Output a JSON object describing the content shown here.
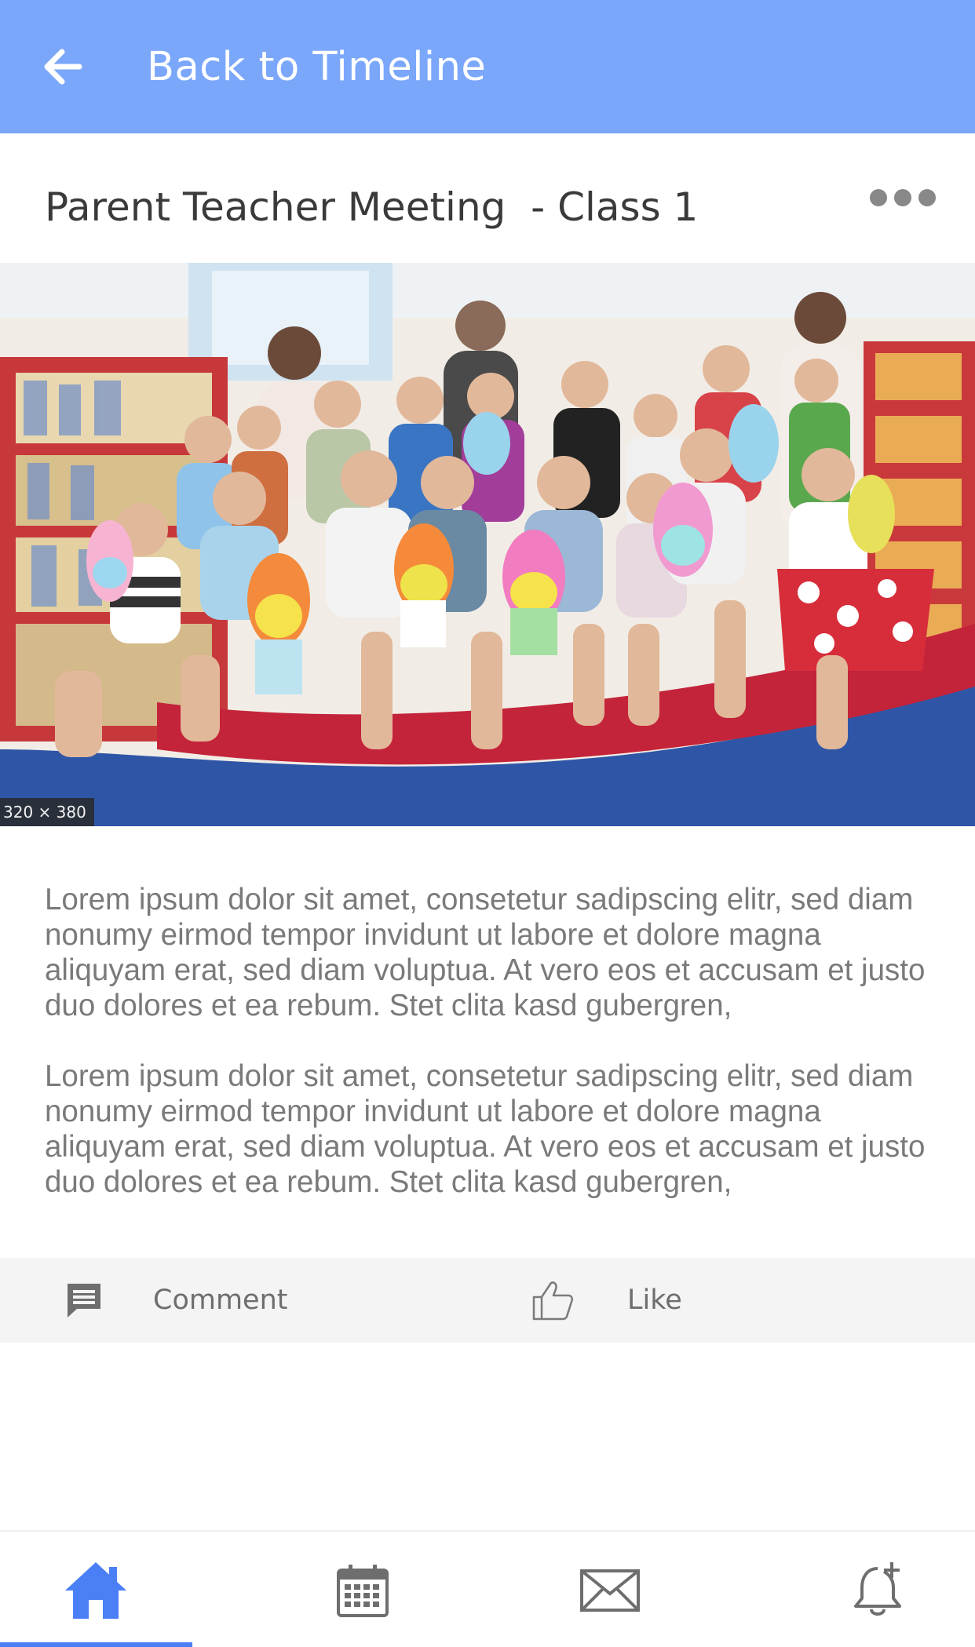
{
  "appbar": {
    "title": "Back to Timeline",
    "back_icon": "arrow-left-icon",
    "background": "#7ba7fb"
  },
  "post": {
    "title": "Parent Teacher Meeting  - Class 1",
    "more_icon": "more-dots-icon",
    "image_dimension_tag": "320 × 380",
    "paragraphs": [
      "Lorem ipsum dolor sit amet, consetetur sadipscing elitr, sed diam nonumy eirmod tempor invidunt ut labore et dolore magna aliquyam erat, sed diam voluptua. At vero eos et accusam et justo duo dolores et ea rebum. Stet clita kasd gubergren,",
      "Lorem ipsum dolor sit amet, consetetur sadipscing elitr, sed diam nonumy eirmod tempor invidunt ut labore et dolore magna aliquyam erat, sed diam voluptua. At vero eos et accusam et justo duo dolores et ea rebum. Stet clita kasd gubergren,"
    ]
  },
  "actions": {
    "comment_label": "Comment",
    "comment_icon": "comment-icon",
    "like_label": "Like",
    "like_icon": "thumbs-up-icon"
  },
  "bottom_nav": {
    "active": "home",
    "accent": "#4a7ff5",
    "items": [
      {
        "id": "home",
        "icon": "home-icon"
      },
      {
        "id": "calendar",
        "icon": "calendar-icon"
      },
      {
        "id": "messages",
        "icon": "mail-icon"
      },
      {
        "id": "notifications",
        "icon": "bell-plus-icon"
      }
    ]
  }
}
